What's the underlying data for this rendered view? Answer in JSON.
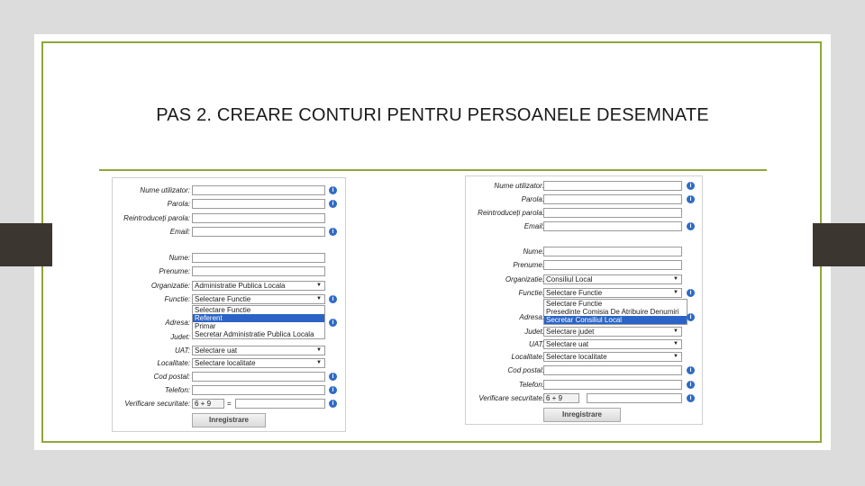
{
  "slide": {
    "title": "PAS 2. CREARE CONTURI PENTRU PERSOANELE DESEMNATE"
  },
  "left_form": {
    "fields": [
      {
        "label": "Nume utilizator:",
        "value": ""
      },
      {
        "label": "Parola:",
        "value": ""
      },
      {
        "label": "Reintroduceți parola:",
        "value": ""
      },
      {
        "label": "Email:",
        "value": ""
      },
      {
        "label": "Nume:",
        "value": ""
      },
      {
        "label": "Prenume:",
        "value": ""
      },
      {
        "label": "Organizatie:",
        "value": "Administratie Publica Locala"
      },
      {
        "label": "Functie:",
        "value": "Selectare Functie"
      },
      {
        "label": "Adresa:",
        "value": ""
      },
      {
        "label": "Judet:",
        "value": ""
      },
      {
        "label": "UAT:",
        "value": "Selectare uat"
      },
      {
        "label": "Localitate:",
        "value": "Selectare localitate"
      },
      {
        "label": "Cod postal:",
        "value": ""
      },
      {
        "label": "Telefon:",
        "value": ""
      },
      {
        "label": "Verificare securitate:",
        "value": "6 + 9"
      }
    ],
    "dropdown_options": [
      "Selectare Functie",
      "Referent",
      "Primar",
      "Secretar Administratie Publica Locala"
    ],
    "highlighted_option": "Referent",
    "captcha_sep": "=",
    "submit_label": "Inregistrare"
  },
  "right_form": {
    "fields": [
      {
        "label": "Nume utilizator:",
        "value": ""
      },
      {
        "label": "Parola:",
        "value": ""
      },
      {
        "label": "Reintroduceți parola:",
        "value": ""
      },
      {
        "label": "Email:",
        "value": ""
      },
      {
        "label": "Nume:",
        "value": ""
      },
      {
        "label": "Prenume:",
        "value": ""
      },
      {
        "label": "Organizatie:",
        "value": "Consiliul Local"
      },
      {
        "label": "Functie:",
        "value": "Selectare Functie"
      },
      {
        "label": "Adresa:",
        "value": ""
      },
      {
        "label": "Judet:",
        "value": "Selectare judet"
      },
      {
        "label": "UAT:",
        "value": "Selectare uat"
      },
      {
        "label": "Localitate:",
        "value": "Selectare localitate"
      },
      {
        "label": "Cod postal:",
        "value": ""
      },
      {
        "label": "Telefon:",
        "value": ""
      },
      {
        "label": "Verificare securitate:",
        "value": "6 + 9"
      }
    ],
    "dropdown_options": [
      "Selectare Functie",
      "Presedinte Comisia De Atribuire Denumiri",
      "Secretar Consiliul Local"
    ],
    "highlighted_option": "Secretar Consiliul Local",
    "submit_label": "Inregistrare"
  },
  "colors": {
    "accent": "#8ea73a",
    "info_icon": "#2f6bc6",
    "highlight": "#2b64c6"
  }
}
